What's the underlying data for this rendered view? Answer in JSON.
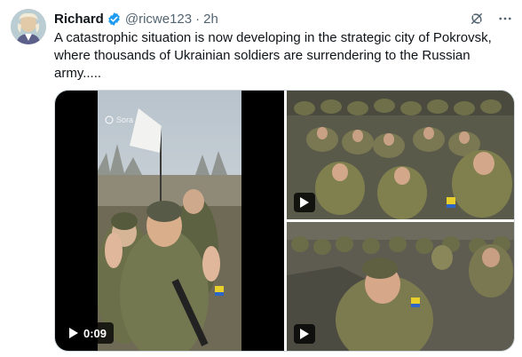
{
  "tweet": {
    "author_name": "Richard",
    "handle": "@ricwe123",
    "separator": "·",
    "time": "2h",
    "text": "A catastrophic situation is now developing in the strategic city of Pokrovsk, where thousands of Ukrainian soldiers are surrendering to the Russian army.....",
    "verified_color": "#1d9bf0"
  },
  "media": {
    "video_duration": "0:09",
    "watermark": "Sora"
  },
  "icons": {
    "grok": "grok-icon",
    "more": "more-icon",
    "play": "play-icon"
  }
}
